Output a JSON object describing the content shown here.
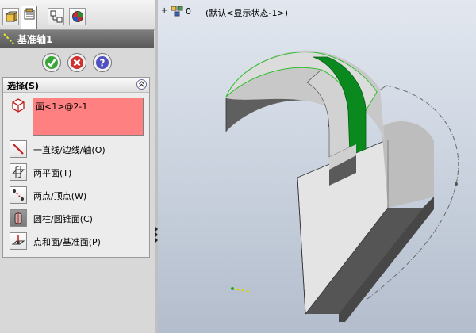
{
  "tabs": [
    {
      "name": "feature-manager"
    },
    {
      "name": "property-manager"
    },
    {
      "name": "configuration-manager"
    },
    {
      "name": "appearance-manager"
    }
  ],
  "panel": {
    "title": "基准轴1",
    "buttons": {
      "ok": "ok-icon",
      "cancel": "cancel-icon",
      "help": "help-icon"
    }
  },
  "selection": {
    "header": "选择(S)",
    "items": [
      "面<1>@2-1"
    ],
    "box_color": "#ff8080",
    "options": [
      {
        "label": "一直线/边线/轴(O)",
        "icon": "line-edge-axis-icon"
      },
      {
        "label": "两平面(T)",
        "icon": "two-planes-icon"
      },
      {
        "label": "两点/顶点(W)",
        "icon": "two-points-icon"
      },
      {
        "label": "圆柱/圆锥面(C)",
        "icon": "cylinder-cone-icon"
      },
      {
        "label": "点和面/基准面(P)",
        "icon": "point-plane-icon"
      }
    ]
  },
  "tree": {
    "expand": "+",
    "count": "0",
    "config": "(默认<显示状态-1>)"
  },
  "colors": {
    "selected_face": "#0a8a1e",
    "highlight_edge": "#33cc33",
    "model_light": "#dadada",
    "model_dark": "#5c5c5c"
  }
}
